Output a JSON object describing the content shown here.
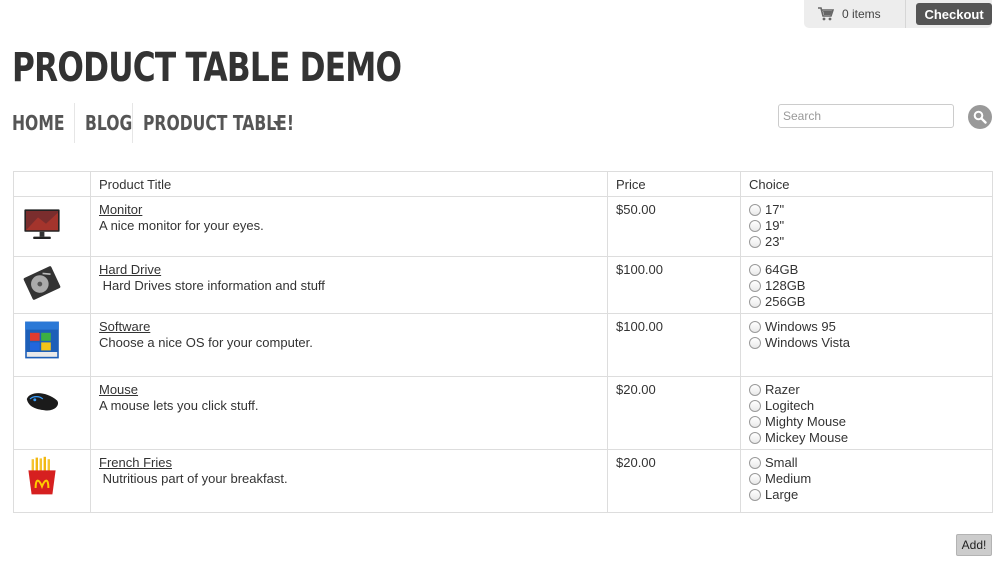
{
  "cart": {
    "icon": "cart-icon",
    "items_label": "0 items",
    "checkout_label": "Checkout"
  },
  "site": {
    "title": "Product Table Demo"
  },
  "nav": {
    "items": [
      {
        "label": "Home"
      },
      {
        "label": "Blog"
      },
      {
        "label": "Product Table!",
        "has_dropdown": true
      }
    ]
  },
  "search": {
    "placeholder": "Search",
    "value": "",
    "icon": "magnifier-icon"
  },
  "table": {
    "headers": [
      "",
      "Product Title",
      "Price",
      "Choice"
    ],
    "rows": [
      {
        "image": "monitor-thumbnail",
        "title": "Monitor",
        "description": "A nice monitor for your eyes.",
        "price": "$50.00",
        "choices": [
          "17\"",
          "19\"",
          "23\""
        ]
      },
      {
        "image": "hard-drive-thumbnail",
        "title": "Hard Drive",
        "description": " Hard Drives store information and stuff",
        "price": "$100.00",
        "choices": [
          "64GB",
          "128GB",
          "256GB"
        ]
      },
      {
        "image": "software-box-thumbnail",
        "title": "Software",
        "description": "Choose a nice OS for your computer.",
        "price": "$100.00",
        "choices": [
          "Windows 95",
          "Windows Vista"
        ]
      },
      {
        "image": "mouse-thumbnail",
        "title": "Mouse",
        "description": "A mouse lets you click stuff.",
        "price": "$20.00",
        "choices": [
          "Razer",
          "Logitech",
          "Mighty Mouse",
          "Mickey Mouse"
        ]
      },
      {
        "image": "french-fries-thumbnail",
        "title": "French Fries",
        "description": " Nutritious part of your breakfast.",
        "price": "$20.00",
        "choices": [
          "Small",
          "Medium",
          "Large"
        ]
      }
    ]
  },
  "add_button": {
    "label": "Add!"
  },
  "colors": {
    "checkout_bg": "#555555",
    "search_button_bg": "#999999",
    "add_button_bg": "#cccccc",
    "border": "#dddddd"
  }
}
